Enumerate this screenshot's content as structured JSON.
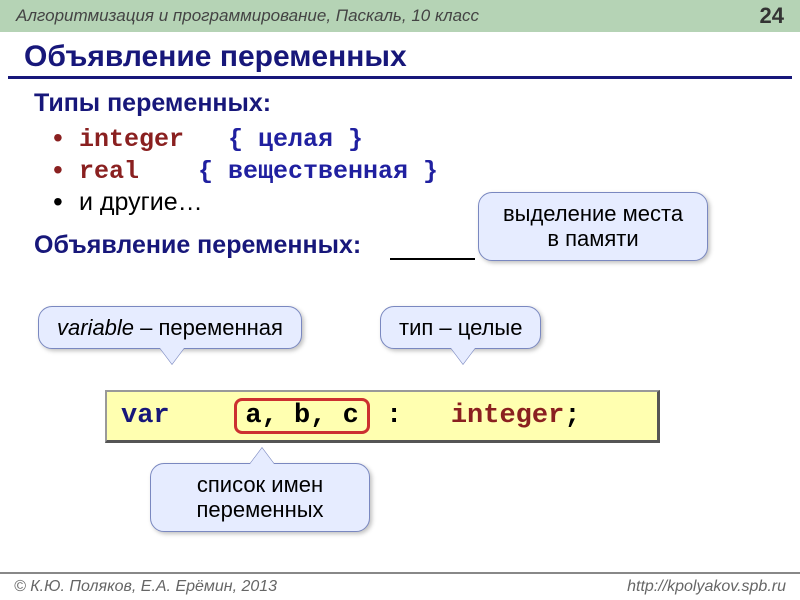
{
  "header": {
    "course": "Алгоритмизация и программирование, Паскаль, 10 класс",
    "page": "24"
  },
  "title": "Объявление переменных",
  "sections": {
    "types_heading": "Типы переменных:",
    "decl_heading": "Объявление переменных:"
  },
  "types": [
    {
      "kw": "integer",
      "comment": "{ целая }"
    },
    {
      "kw": "real",
      "comment": "{ вещественная }"
    }
  ],
  "other": "и другие…",
  "callouts": {
    "memory": "выделение места в памяти",
    "variable_italic": "variable",
    "variable_rest": " – переменная",
    "type": "тип – целые",
    "list": "список имен переменных"
  },
  "code": {
    "kw": "var",
    "vars": "a, b, c",
    "colon": ":",
    "type": "integer",
    "semi": ";"
  },
  "footer": {
    "left": "© К.Ю. Поляков, Е.А. Ерёмин, 2013",
    "right": "http://kpolyakov.spb.ru"
  }
}
